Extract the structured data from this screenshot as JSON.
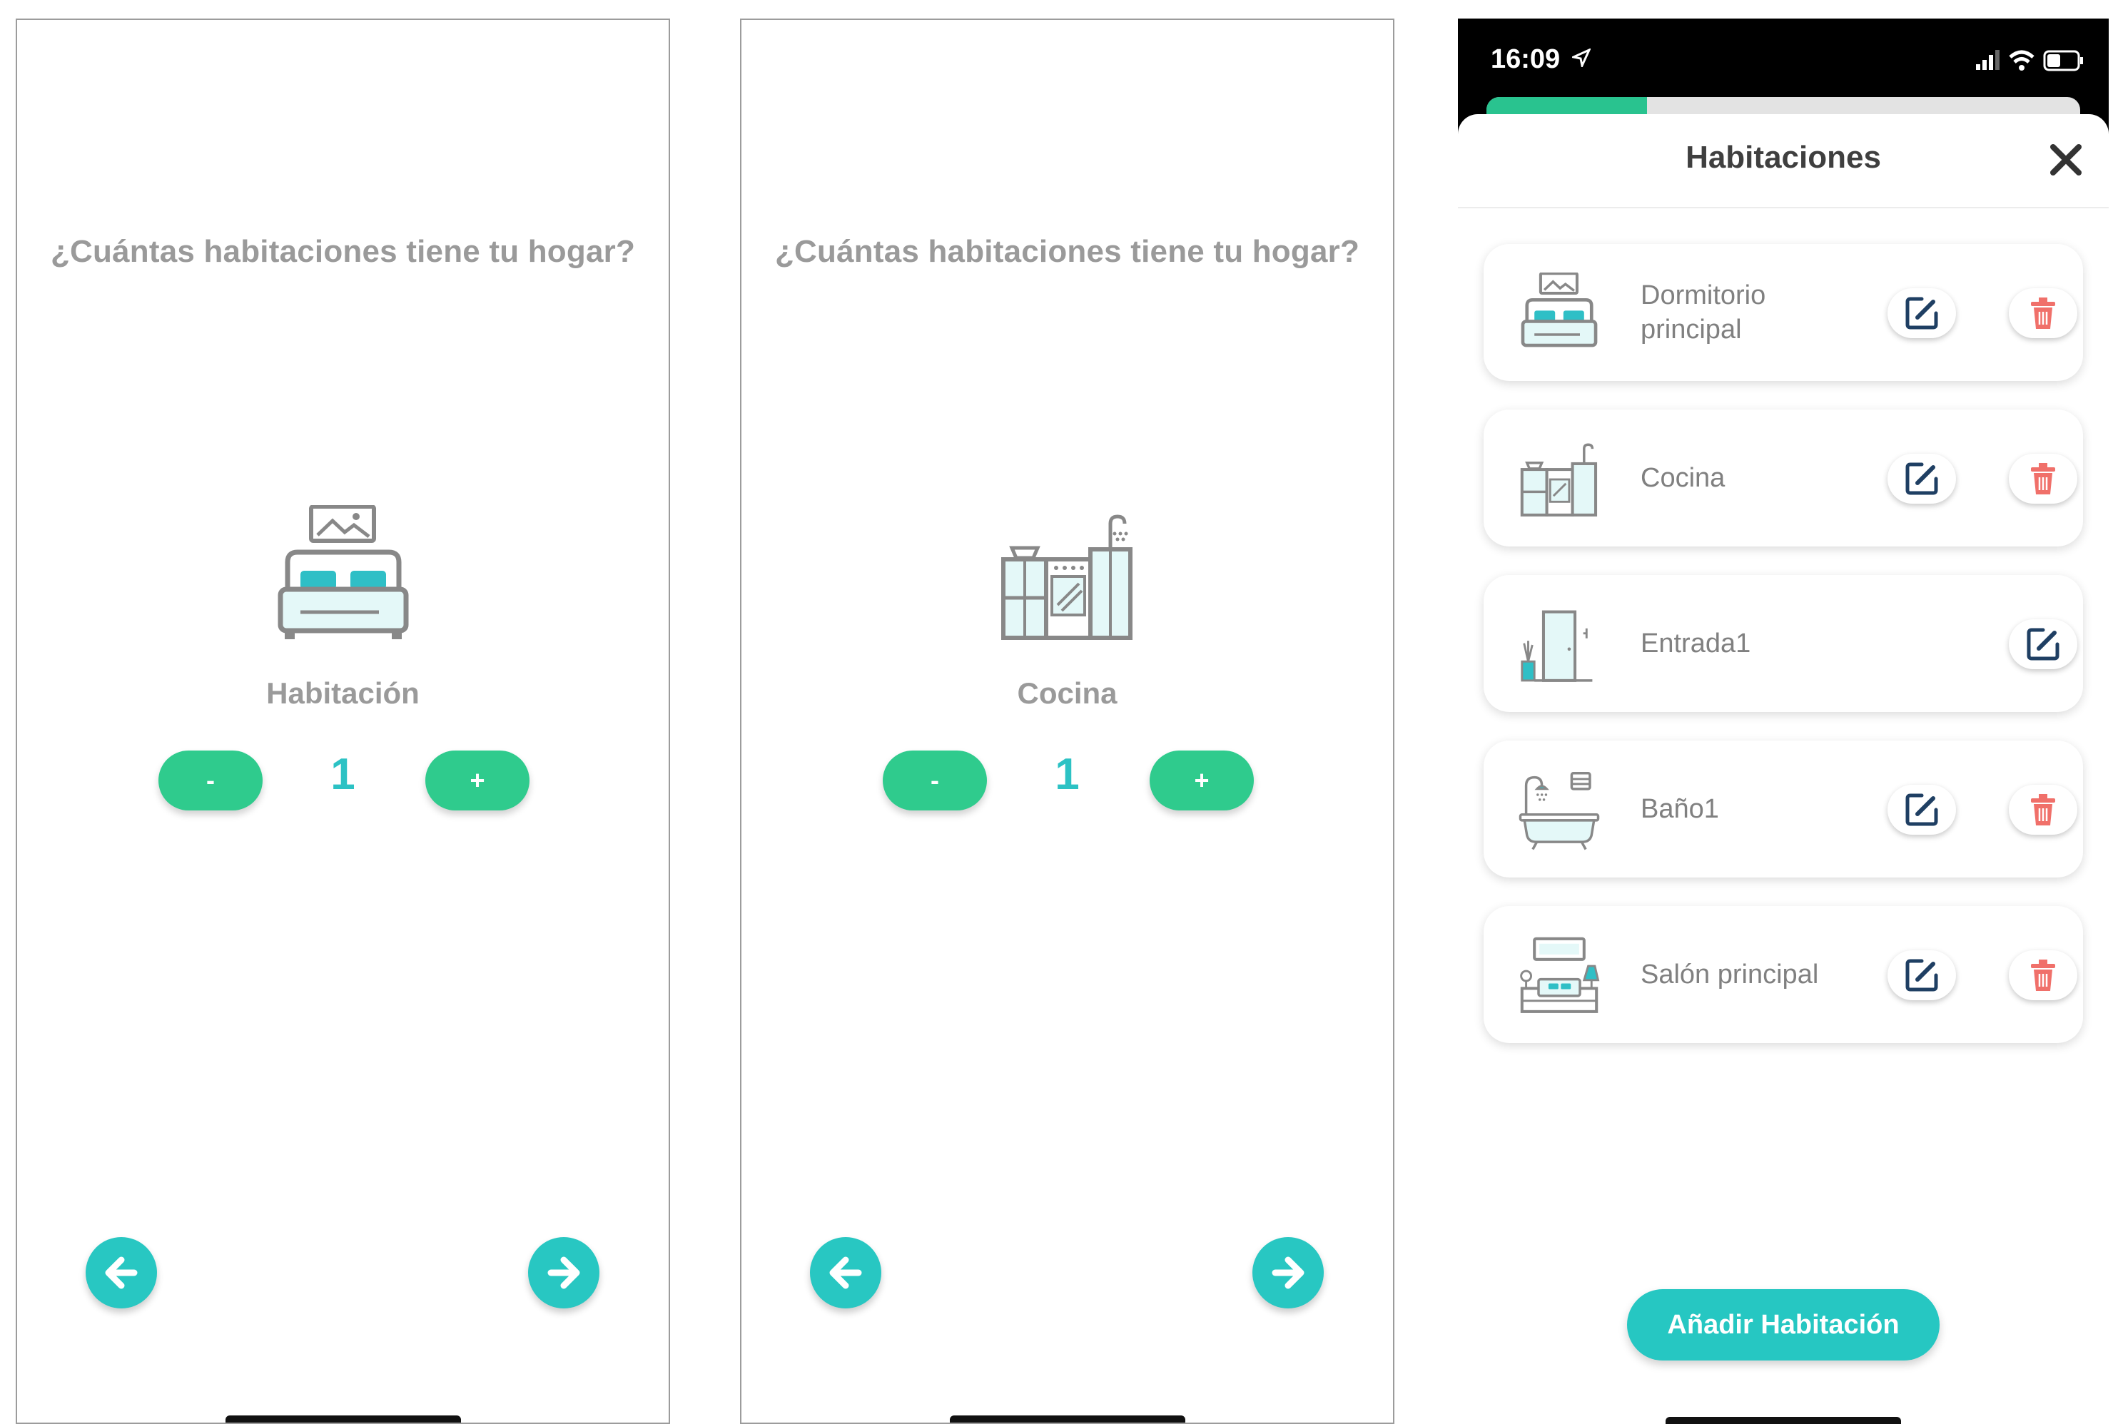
{
  "screen1": {
    "question": "¿Cuántas habitaciones tiene tu hogar?",
    "room_type": "Habitación",
    "icon": "bed-icon",
    "minus_label": "-",
    "plus_label": "+",
    "count": "1"
  },
  "screen2": {
    "question": "¿Cuántas habitaciones tiene tu hogar?",
    "room_type": "Cocina",
    "icon": "kitchen-icon",
    "minus_label": "-",
    "plus_label": "+",
    "count": "1"
  },
  "screen3": {
    "status_time": "16:09",
    "progress": 0.27,
    "title": "Habitaciones",
    "rooms": [
      {
        "name": "Dormitorio principal",
        "icon": "bed-icon",
        "deletable": true
      },
      {
        "name": "Cocina",
        "icon": "kitchen-icon",
        "deletable": true
      },
      {
        "name": "Entrada1",
        "icon": "entrance-door-icon",
        "deletable": false
      },
      {
        "name": "Baño1",
        "icon": "bathtub-icon",
        "deletable": true
      },
      {
        "name": "Salón principal",
        "icon": "living-room-icon",
        "deletable": true
      }
    ],
    "add_button_label": "Añadir Habitación"
  },
  "colors": {
    "green": "#2fcb8d",
    "teal": "#28c7c2",
    "delete_red": "#f0706a",
    "edit_navy": "#1f3f63"
  }
}
